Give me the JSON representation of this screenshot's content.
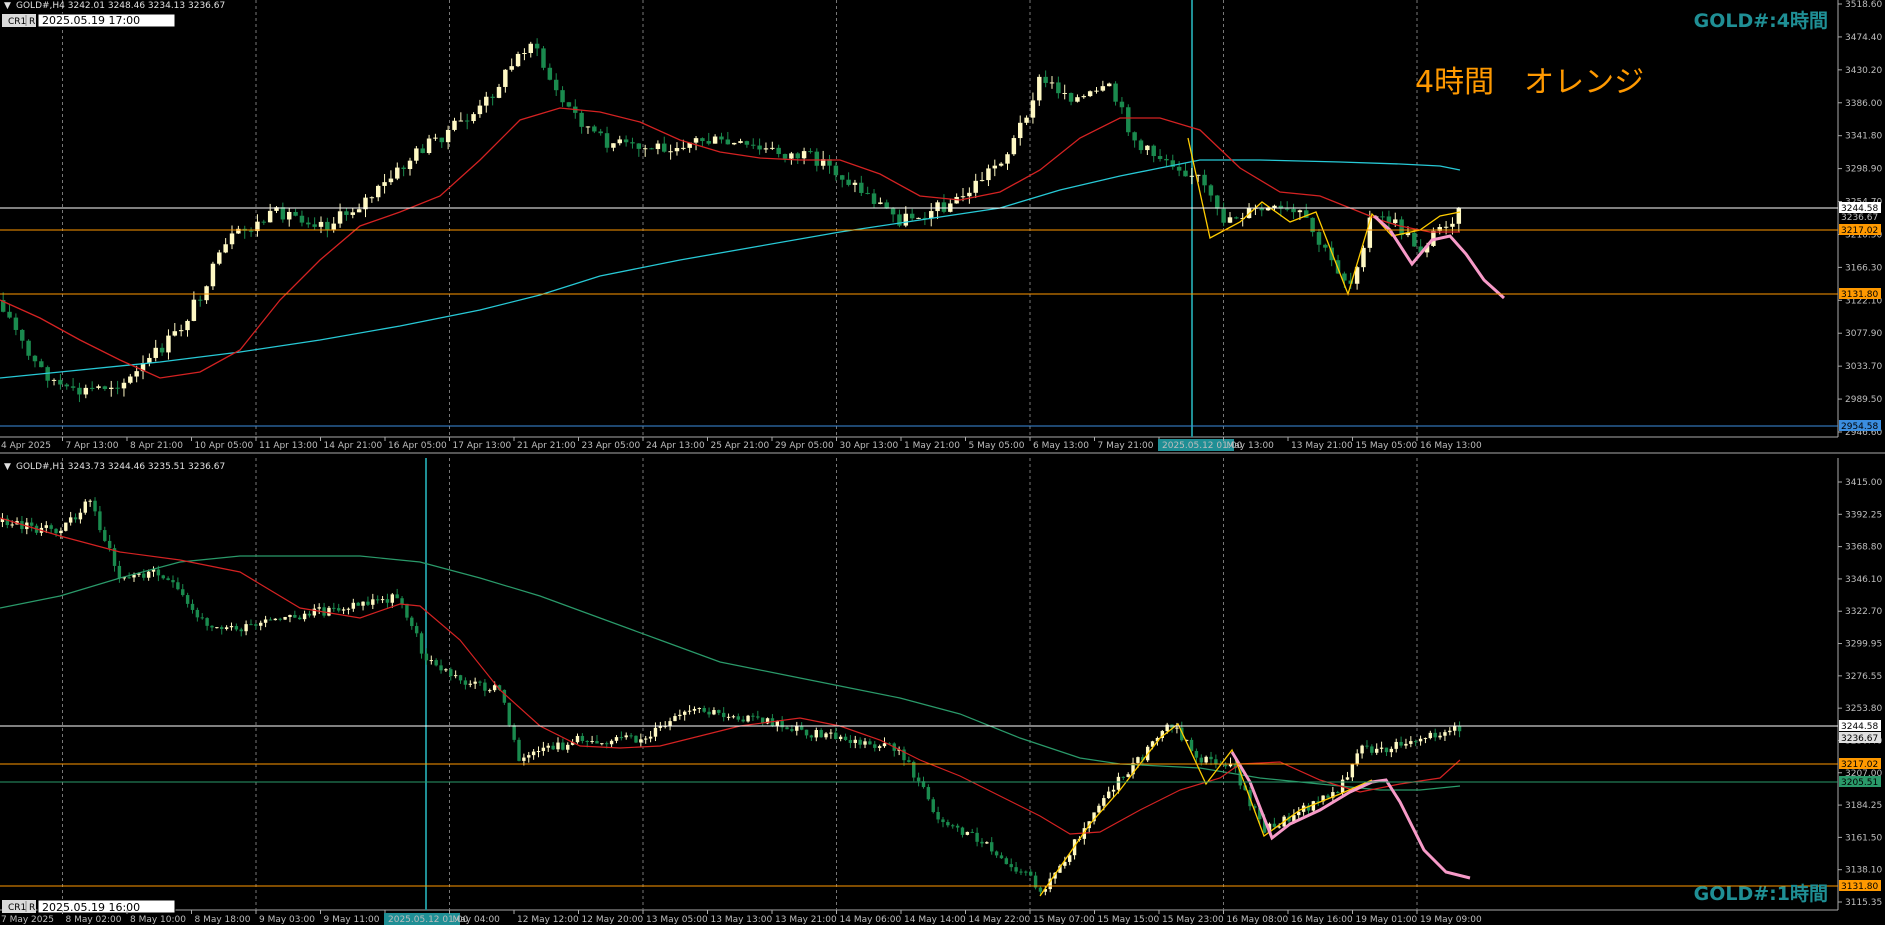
{
  "colors": {
    "bull": "#fff9c4",
    "bear": "#1a8a4e",
    "ema_fast": "#d42222",
    "ema_slow_top": "#27c9d6",
    "ema_slow_bot": "#2a9a6a",
    "orange_level": "#ff9900",
    "white_level": "#ffffff",
    "zigzag": "#ffcc00",
    "forecast": "#f79ac8",
    "vline": "#1f8f95",
    "grid": "#777777",
    "watermark": "#1f8f95"
  },
  "top": {
    "header": "GOLD#,H4  3242.01 3248.46 3234.13 3236.67",
    "buttons": [
      "CR1",
      "R"
    ],
    "datetime": "2025.05.19 17:00",
    "watermark": "GOLD#:4時間",
    "annotation": "4時間　オレンジ",
    "price_labels": [
      "3518.60",
      "3474.40",
      "3430.20",
      "3386.00",
      "3341.80",
      "3298.90",
      "3254.70",
      "3210.50",
      "3166.30",
      "3122.10",
      "3077.90",
      "3033.70",
      "2989.50",
      "2946.60"
    ],
    "level_labels": {
      "white": "3244.58",
      "gray": "3236.67",
      "orange1": "3217.02",
      "orange2": "3131.80",
      "blue": "2954.58"
    },
    "time_labels": [
      "4 Apr 2025",
      "7 Apr 13:00",
      "8 Apr 21:00",
      "10 Apr 05:00",
      "11 Apr 13:00",
      "14 Apr 21:00",
      "16 Apr 05:00",
      "17 Apr 13:00",
      "21 Apr 21:00",
      "23 Apr 05:00",
      "24 Apr 13:00",
      "25 Apr 21:00",
      "29 Apr 05:00",
      "30 Apr 13:00",
      "1 May 21:00",
      "5 May 05:00",
      "6 May 13:00",
      "7 May 21:00",
      "2025.05.12 01:00",
      "May 13:00",
      "13 May 21:00",
      "15 May 05:00",
      "16 May 13:00"
    ]
  },
  "bottom": {
    "header": "GOLD#,H1  3243.73 3244.46 3235.51 3236.67",
    "buttons": [
      "CR1",
      "R"
    ],
    "datetime": "2025.05.19 16:00",
    "watermark": "GOLD#:1時間",
    "price_labels": [
      "3415.00",
      "3392.25",
      "3368.80",
      "3346.10",
      "3322.70",
      "3299.95",
      "3276.55",
      "3253.80",
      "3230.40",
      "3207.00",
      "3184.25",
      "3161.50",
      "3138.10",
      "3115.35"
    ],
    "level_labels": {
      "white": "3244.58",
      "gray": "3236.67",
      "orange1": "3217.02",
      "green": "3205.51",
      "orange2": "3131.80"
    },
    "time_labels": [
      "7 May 2025",
      "8 May 02:00",
      "8 May 10:00",
      "8 May 18:00",
      "9 May 03:00",
      "9 May 11:00",
      "2025.05.12 01:00",
      "May 04:00",
      "12 May 12:00",
      "12 May 20:00",
      "13 May 05:00",
      "13 May 13:00",
      "13 May 21:00",
      "14 May 06:00",
      "14 May 14:00",
      "14 May 22:00",
      "15 May 07:00",
      "15 May 15:00",
      "15 May 23:00",
      "16 May 08:00",
      "16 May 16:00",
      "19 May 01:00",
      "19 May 09:00"
    ]
  },
  "chart_data": [
    {
      "type": "candlestick",
      "timeframe": "H4",
      "ylim": [
        2946.6,
        3518.6
      ],
      "ohlc_sample": [
        {
          "t": "4 Apr 2025",
          "o": 3110,
          "h": 3135,
          "l": 3015,
          "c": 3030
        },
        {
          "t": "7 Apr 13:00",
          "o": 3010,
          "h": 3055,
          "l": 2970,
          "c": 3000
        },
        {
          "t": "10 Apr 05:00",
          "o": 3080,
          "h": 3170,
          "l": 3070,
          "c": 3160
        },
        {
          "t": "11 Apr 13:00",
          "o": 3200,
          "h": 3245,
          "l": 3190,
          "c": 3230
        },
        {
          "t": "17 Apr 13:00",
          "o": 3330,
          "h": 3355,
          "l": 3310,
          "c": 3345
        },
        {
          "t": "21 Apr 21:00",
          "o": 3420,
          "h": 3500,
          "l": 3400,
          "c": 3480
        },
        {
          "t": "23 Apr 05:00",
          "o": 3380,
          "h": 3390,
          "l": 3260,
          "c": 3290
        },
        {
          "t": "1 May 21:00",
          "o": 3230,
          "h": 3260,
          "l": 3205,
          "c": 3240
        },
        {
          "t": "6 May 13:00",
          "o": 3380,
          "h": 3435,
          "l": 3360,
          "c": 3420
        },
        {
          "t": "2025.05.12 01:00",
          "o": 3320,
          "h": 3330,
          "l": 3240,
          "c": 3250
        },
        {
          "t": "15 May 05:00",
          "o": 3150,
          "h": 3180,
          "l": 3120,
          "c": 3175
        },
        {
          "t": "16 May 13:00",
          "o": 3210,
          "h": 3245,
          "l": 3200,
          "c": 3237
        }
      ],
      "levels": [
        3244.58,
        3217.02,
        3131.8,
        2954.58
      ]
    },
    {
      "type": "candlestick",
      "timeframe": "H1",
      "ylim": [
        3115.35,
        3415.0
      ],
      "ohlc_sample": [
        {
          "t": "7 May 2025",
          "o": 3395,
          "h": 3400,
          "l": 3385,
          "c": 3390
        },
        {
          "t": "8 May 10:00",
          "o": 3360,
          "h": 3370,
          "l": 3320,
          "c": 3330
        },
        {
          "t": "9 May 03:00",
          "o": 3300,
          "h": 3330,
          "l": 3285,
          "c": 3320
        },
        {
          "t": "2025.05.12 01:00",
          "o": 3320,
          "h": 3325,
          "l": 3270,
          "c": 3280
        },
        {
          "t": "12 May 12:00",
          "o": 3230,
          "h": 3240,
          "l": 3205,
          "c": 3215
        },
        {
          "t": "13 May 13:00",
          "o": 3250,
          "h": 3262,
          "l": 3240,
          "c": 3255
        },
        {
          "t": "14 May 22:00",
          "o": 3175,
          "h": 3185,
          "l": 3150,
          "c": 3160
        },
        {
          "t": "15 May 15:00",
          "o": 3230,
          "h": 3252,
          "l": 3225,
          "c": 3248
        },
        {
          "t": "16 May 08:00",
          "o": 3190,
          "h": 3200,
          "l": 3160,
          "c": 3170
        },
        {
          "t": "19 May 09:00",
          "o": 3240,
          "h": 3248,
          "l": 3232,
          "c": 3237
        }
      ],
      "levels": [
        3244.58,
        3217.02,
        3205.51,
        3131.8
      ]
    }
  ]
}
